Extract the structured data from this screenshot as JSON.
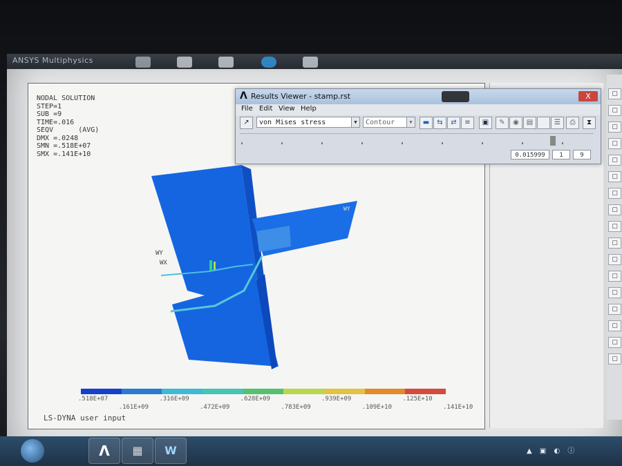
{
  "app": {
    "title": "ANSYS Multiphysics"
  },
  "legend": {
    "lines": [
      "NODAL SOLUTION",
      "",
      "STEP=1",
      "SUB =9",
      "TIME=.016",
      "SEQV      (AVG)",
      "DMX =.0248",
      "SMN =.518E+07",
      "SMX =.141E+10"
    ]
  },
  "triad_labels": [
    "WX",
    "WY"
  ],
  "contour": {
    "colors": [
      "#1441c9",
      "#2a7ad2",
      "#3fb9d6",
      "#46c4b4",
      "#55c06f",
      "#b9d64f",
      "#e3c243",
      "#e38a2d",
      "#d44a40"
    ],
    "labels": [
      ".518E+07",
      ".161E+09",
      ".316E+09",
      ".472E+09",
      ".628E+09",
      ".783E+09",
      ".939E+09",
      ".109E+10",
      ".125E+10",
      ".141E+10"
    ]
  },
  "status": "LS-DYNA user input",
  "results_viewer": {
    "title": "Results Viewer - stamp.rst",
    "menu": [
      "File",
      "Edit",
      "View",
      "Help"
    ],
    "result_item": "von Mises stress",
    "plot_type": "Contour",
    "close_label": "X",
    "time_value": "0.015999",
    "set_start": "1",
    "set_end": "9",
    "slider_fraction": 0.89
  },
  "taskbar": {
    "start_label": "",
    "apps": [
      "Λ",
      "▦",
      "W"
    ]
  }
}
